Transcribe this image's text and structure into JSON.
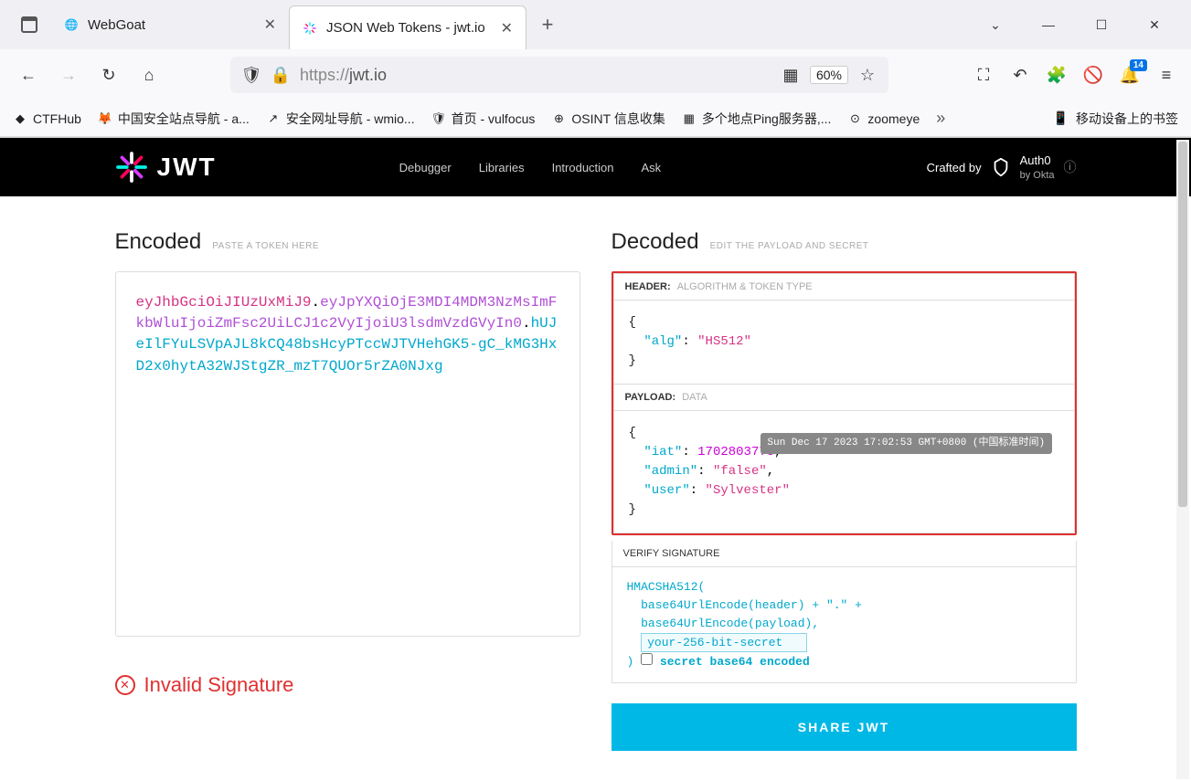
{
  "browser": {
    "tabs": [
      {
        "title": "WebGoat",
        "active": false
      },
      {
        "title": "JSON Web Tokens - jwt.io",
        "active": true
      }
    ],
    "url_proto": "https://",
    "url_host": "jwt.io",
    "zoom": "60%",
    "notif_count": "14"
  },
  "bookmarks": [
    {
      "icon": "◆",
      "label": "CTFHub"
    },
    {
      "icon": "🦊",
      "label": "中国安全站点导航 - a..."
    },
    {
      "icon": "↗",
      "label": "安全网址导航 - wmio..."
    },
    {
      "icon": "🛡",
      "label": "首页 - vulfocus"
    },
    {
      "icon": "⊕",
      "label": "OSINT 信息收集"
    },
    {
      "icon": "▦",
      "label": "多个地点Ping服务器,..."
    },
    {
      "icon": "⊙",
      "label": "zoomeye"
    }
  ],
  "bookmarks_right": "移动设备上的书签",
  "site_nav": {
    "items": [
      "Debugger",
      "Libraries",
      "Introduction",
      "Ask"
    ],
    "crafted": "Crafted by",
    "brand1": "Auth0",
    "brand2": "by Okta"
  },
  "algo_label": "Algorithm",
  "algo_value": "HS512",
  "encoded": {
    "title": "Encoded",
    "subtitle": "PASTE A TOKEN HERE",
    "header": "eyJhbGciOiJIUzUxMiJ9",
    "payload": "eyJpYXQiOjE3MDI4MDM3NzMsImFkbWluIjoiZmFsc2UiLCJ1c2VyIjoiU3lsdmVzdGVyIn0",
    "sig": "hUJeIlFYuLSVpAJL8kCQ48bsHcyPTccWJTVHehGK5-gC_kMG3HxD2x0hytA32WJStgZR_mzT7QUOr5rZA0NJxg"
  },
  "decoded": {
    "title": "Decoded",
    "subtitle": "EDIT THE PAYLOAD AND SECRET",
    "header_label": "HEADER:",
    "header_muted": "ALGORITHM & TOKEN TYPE",
    "header_json": {
      "alg": "HS512"
    },
    "payload_label": "PAYLOAD:",
    "payload_muted": "DATA",
    "payload_json": {
      "iat": 1702803773,
      "admin": "false",
      "user": "Sylvester"
    },
    "iat_tooltip": "Sun Dec 17 2023 17:02:53 GMT+0800 (中国标准时间)",
    "verify_label": "VERIFY SIGNATURE",
    "sig_fn": "HMACSHA512(",
    "sig_l1": "base64UrlEncode(header) + \".\" +",
    "sig_l2": "base64UrlEncode(payload),",
    "secret_placeholder": "your-256-bit-secret",
    "sig_close": ")",
    "secret_check_label": "secret base64 encoded"
  },
  "invalid_label": "Invalid Signature",
  "share_label": "SHARE JWT"
}
